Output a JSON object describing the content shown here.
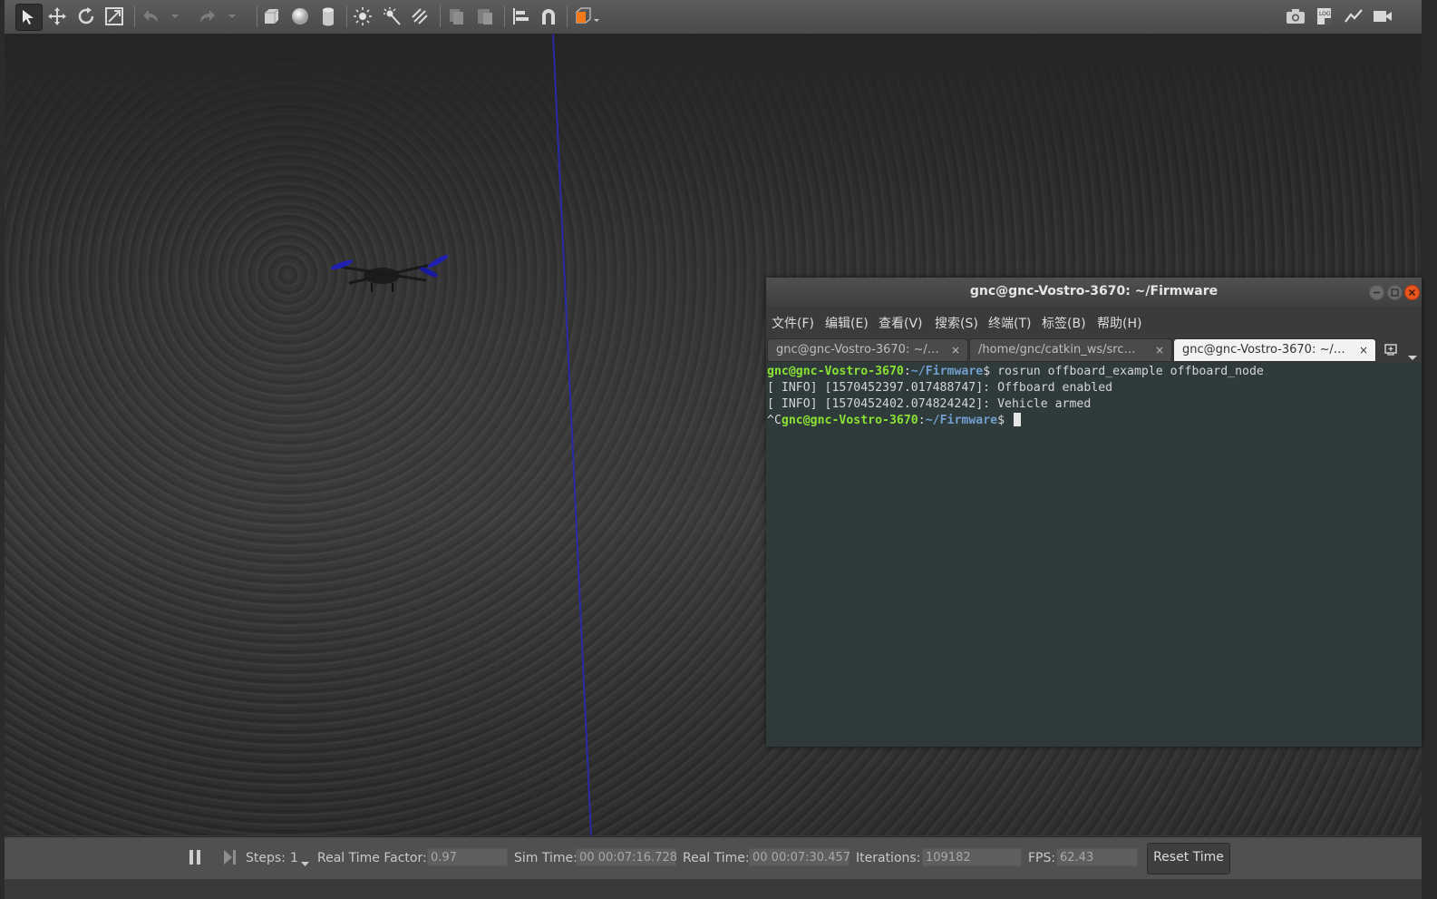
{
  "gazebo": {
    "toolbar": {
      "tools": [
        {
          "name": "select-arrow-icon",
          "active": true
        },
        {
          "name": "translate-icon"
        },
        {
          "name": "rotate-icon"
        },
        {
          "name": "scale-icon"
        },
        {
          "name": "undo-icon"
        },
        {
          "name": "redo-icon"
        },
        {
          "name": "box-shape-icon"
        },
        {
          "name": "sphere-shape-icon"
        },
        {
          "name": "cylinder-shape-icon"
        },
        {
          "name": "point-light-icon"
        },
        {
          "name": "spot-light-icon"
        },
        {
          "name": "directional-light-icon"
        },
        {
          "name": "copy-icon"
        },
        {
          "name": "paste-icon"
        },
        {
          "name": "align-icon"
        },
        {
          "name": "snap-magnet-icon"
        },
        {
          "name": "view-angle-icon"
        }
      ],
      "right_tools": [
        "screenshot-icon",
        "log-icon",
        "plot-icon",
        "record-video-icon"
      ],
      "accent_color": "#f07a1a"
    },
    "bottom_bar": {
      "steps_label": "Steps:",
      "steps_value": "1",
      "rtf_label": "Real Time Factor:",
      "rtf_value": "0.97",
      "sim_time_label": "Sim Time:",
      "sim_time_value": "00 00:07:16.728",
      "real_time_label": "Real Time:",
      "real_time_value": "00 00:07:30.457",
      "iterations_label": "Iterations:",
      "iterations_value": "109182",
      "fps_label": "FPS:",
      "fps_value": "62.43",
      "reset_label": "Reset Time"
    }
  },
  "terminal": {
    "title": "gnc@gnc-Vostro-3670: ~/Firmware",
    "menu": [
      "文件(F)",
      "编辑(E)",
      "查看(V)",
      "搜索(S)",
      "终端(T)",
      "标签(B)",
      "帮助(H)"
    ],
    "tabs": [
      {
        "label": "gnc@gnc-Vostro-3670: ~/…",
        "close": "×"
      },
      {
        "label": "/home/gnc/catkin_ws/src…",
        "close": "×"
      },
      {
        "label": "gnc@gnc-Vostro-3670: ~/…",
        "close": "×",
        "active": true
      }
    ],
    "lines": {
      "l1_user": "gnc@gnc-Vostro-3670",
      "l1_sep": ":",
      "l1_path": "~/Firmware",
      "l1_cmd": "$ rosrun offboard_example offboard_node",
      "l2": "[ INFO] [1570452397.017488747]: Offboard enabled",
      "l3": "[ INFO] [1570452402.074824242]: Vehicle armed",
      "l4_pre": "^C",
      "l4_user": "gnc@gnc-Vostro-3670",
      "l4_sep": ":",
      "l4_path": "~/Firmware",
      "l4_prompt": "$ "
    }
  }
}
